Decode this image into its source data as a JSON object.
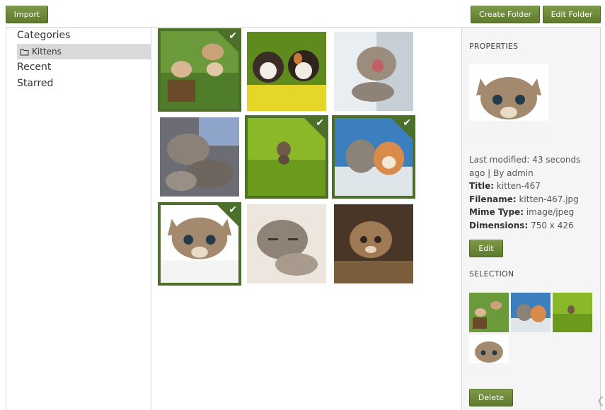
{
  "toolbar": {
    "import_label": "Import",
    "create_folder_label": "Create Folder",
    "edit_folder_label": "Edit Folder"
  },
  "sidebar": {
    "categories_label": "Categories",
    "folder_label": "Kittens",
    "recent_label": "Recent",
    "starred_label": "Starred"
  },
  "gallery": {
    "images": [
      {
        "name": "kitten-playing-stump",
        "selected": true
      },
      {
        "name": "kitten-pair-flowers",
        "selected": false
      },
      {
        "name": "kitten-yawning",
        "selected": false
      },
      {
        "name": "kittens-sleeping-pile",
        "selected": false
      },
      {
        "name": "kitten-grass",
        "selected": true
      },
      {
        "name": "kittens-two",
        "selected": true
      },
      {
        "name": "kitten-467",
        "selected": true
      },
      {
        "name": "kitten-sleeping",
        "selected": false
      },
      {
        "name": "kitten-sitting",
        "selected": false
      }
    ],
    "check_glyph": "✔"
  },
  "properties": {
    "title": "PROPERTIES",
    "last_modified_label": "Last modified: 43 seconds ago | By admin",
    "title_key": "Title:",
    "title_value": "kitten-467",
    "filename_key": "Filename:",
    "filename_value": "kitten-467.jpg",
    "mime_key": "Mime Type:",
    "mime_value": "image/jpeg",
    "dimensions_key": "Dimensions:",
    "dimensions_value": "750 x 426",
    "edit_label": "Edit"
  },
  "selection": {
    "title": "SELECTION",
    "delete_label": "Delete"
  },
  "colors": {
    "accent": "#5e7a2e",
    "selected_border": "#4c6f2a"
  }
}
